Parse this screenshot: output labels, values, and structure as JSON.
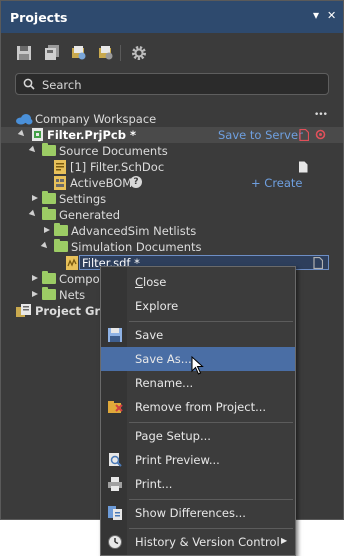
{
  "panel": {
    "title": "Projects",
    "dropdown_glyph": "▾",
    "close_glyph": "✕"
  },
  "toolbar": {
    "icons": [
      "save-icon",
      "save-all-icon",
      "open-project-icon",
      "close-project-icon",
      "settings-gear-icon"
    ]
  },
  "search": {
    "placeholder": "Search"
  },
  "tree": {
    "workspace": "Company Workspace",
    "more_glyph": "•••",
    "project": "Filter.PrjPcb *",
    "save_to_server": "Save to Server",
    "source_documents": "Source Documents",
    "schdoc": "[1] Filter.SchDoc",
    "activebom": "ActiveBOM",
    "help_glyph": "?",
    "create": "+ Create",
    "settings": "Settings",
    "generated": "Generated",
    "advancedsim": "AdvancedSim Netlists",
    "simulation_documents": "Simulation Documents",
    "filter_sdf": "Filter.sdf *",
    "components": "Compon",
    "nets": "Nets",
    "project_group": "Project Group"
  },
  "context_menu": {
    "close": "Close",
    "explore": "Explore",
    "save": "Save",
    "save_as": "Save As...",
    "rename": "Rename...",
    "remove": "Remove from Project...",
    "page_setup": "Page Setup...",
    "print_preview": "Print Preview...",
    "print": "Print...",
    "show_differences": "Show Differences...",
    "history": "History & Version Control",
    "submenu_glyph": "▶"
  },
  "colors": {
    "titlebar": "#2e4a6e",
    "panel_bg": "#3b3b3b",
    "folder": "#9ccc65",
    "highlight": "#4a6ea5",
    "link": "#6fa0e0",
    "accent_red": "#e0505a"
  }
}
